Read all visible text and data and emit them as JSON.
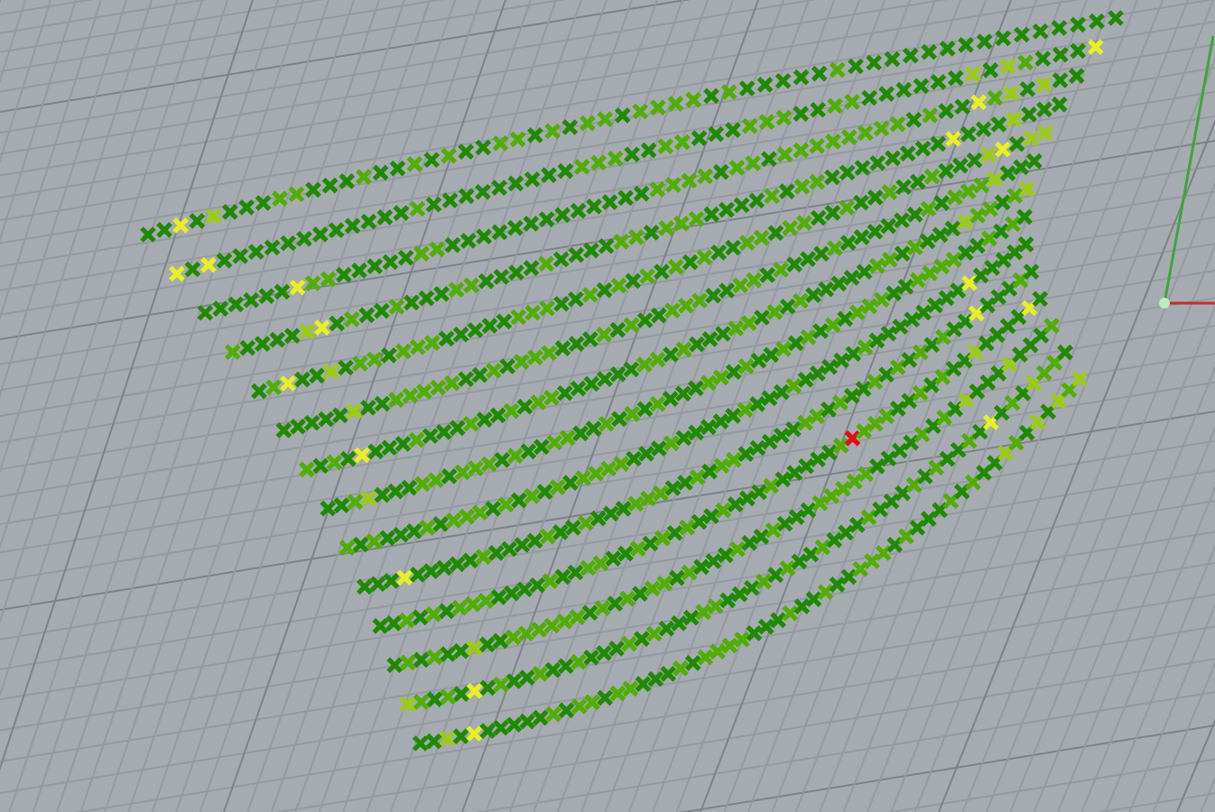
{
  "viewport": {
    "grid": true,
    "axes": true,
    "points": true
  }
}
